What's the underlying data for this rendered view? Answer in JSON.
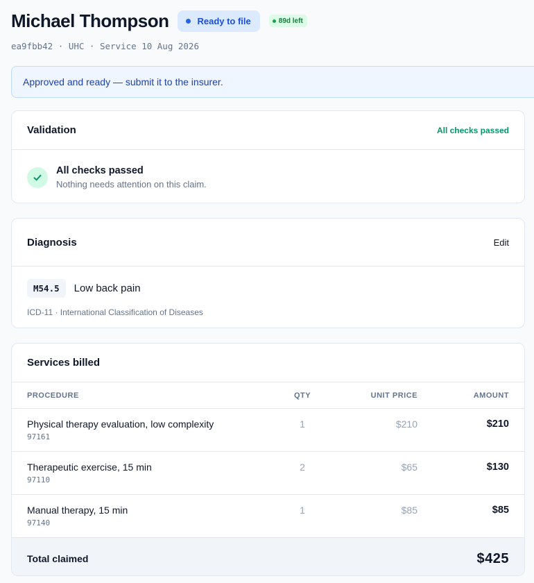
{
  "claim": {
    "patient_name": "Michael Thompson",
    "status": "Ready to file",
    "days_left": "89d left",
    "claim_id": "ea9fbb42",
    "payer": "UHC",
    "service_label": "Service",
    "service_date": "10 Aug 2026",
    "meta_separator": "·"
  },
  "banner": {
    "message": "Approved and ready — submit it to the insurer."
  },
  "validation": {
    "title": "Validation",
    "summary": "All checks passed",
    "check_title": "All checks passed",
    "check_subtitle": "Nothing needs attention on this claim.",
    "icon": "check-icon"
  },
  "diagnosis": {
    "title": "Diagnosis",
    "edit_label": "Edit",
    "code": "M54.5",
    "name": "Low back pain",
    "system": "ICD-11 · International Classification of Diseases"
  },
  "services": {
    "title": "Services billed",
    "columns": {
      "procedure": "PROCEDURE",
      "qty": "QTY",
      "unit_price": "UNIT PRICE",
      "amount": "AMOUNT"
    },
    "rows": [
      {
        "name": "Physical therapy evaluation, low complexity",
        "code": "97161",
        "qty": "1",
        "unit_price": "$210",
        "amount": "$210"
      },
      {
        "name": "Therapeutic exercise, 15 min",
        "code": "97110",
        "qty": "2",
        "unit_price": "$65",
        "amount": "$130"
      },
      {
        "name": "Manual therapy, 15 min",
        "code": "97140",
        "qty": "1",
        "unit_price": "$85",
        "amount": "$85"
      }
    ],
    "total_label": "Total claimed",
    "total_amount": "$425"
  },
  "colors": {
    "status_blue": "#2563eb",
    "success_green": "#059669",
    "banner_bg": "#eff6ff"
  }
}
